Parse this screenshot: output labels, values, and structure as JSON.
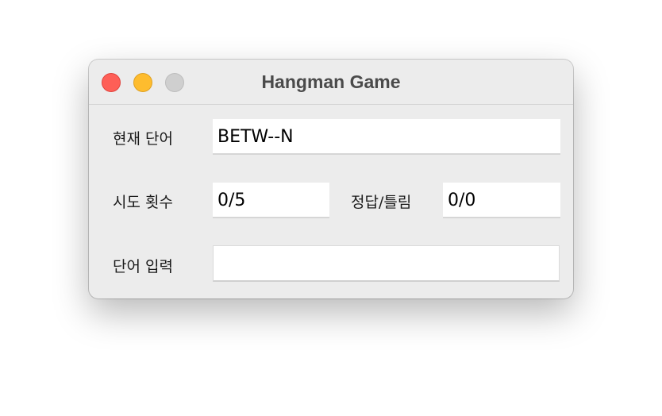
{
  "window": {
    "title": "Hangman Game"
  },
  "current_word": {
    "label": "현재 단어",
    "value": "BETW--N"
  },
  "attempts": {
    "label": "시도 횟수",
    "value": "0/5"
  },
  "correct_wrong": {
    "label": "정답/틀림",
    "value": "0/0"
  },
  "word_input": {
    "label": "단어 입력",
    "value": ""
  }
}
